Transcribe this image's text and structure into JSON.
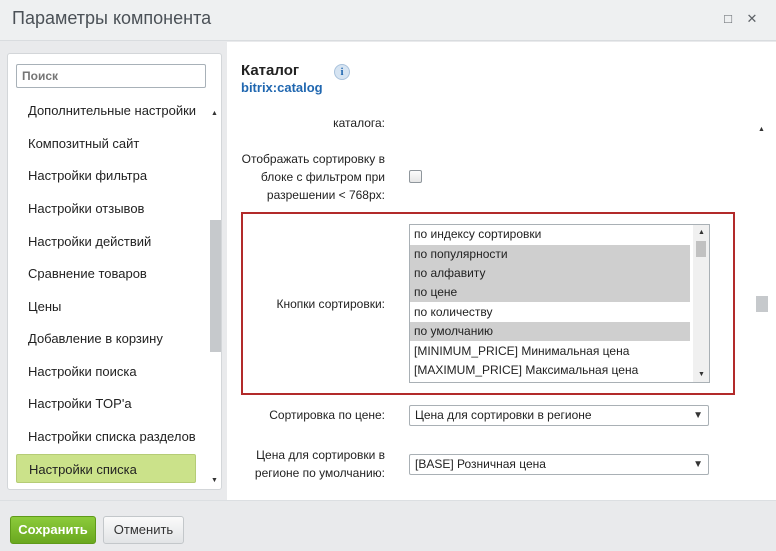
{
  "window": {
    "title": "Параметры компонента",
    "maximize_glyph": "□",
    "close_glyph": "✕"
  },
  "sidebar": {
    "search_placeholder": "Поиск",
    "items": [
      {
        "label": "Дополнительные настройки"
      },
      {
        "label": "Композитный сайт"
      },
      {
        "label": "Настройки фильтра"
      },
      {
        "label": "Настройки отзывов"
      },
      {
        "label": "Настройки действий"
      },
      {
        "label": "Сравнение товаров"
      },
      {
        "label": "Цены"
      },
      {
        "label": "Добавление в корзину"
      },
      {
        "label": "Настройки поиска"
      },
      {
        "label": "Настройки TOP'а"
      },
      {
        "label": "Настройки списка разделов"
      },
      {
        "label": "Настройки списка",
        "active": true
      }
    ]
  },
  "component": {
    "title": "Каталог",
    "id": "bitrix:catalog",
    "info_glyph": "i"
  },
  "form": {
    "catalog_label": "каталога:",
    "sort_in_filter_label_1": "Отображать сортировку в",
    "sort_in_filter_label_2": "блоке с фильтром при",
    "sort_in_filter_label_3": "разрешении < 768px:",
    "sort_buttons_label": "Кнопки сортировки:",
    "sort_buttons_options": [
      {
        "label": "по индексу сортировки",
        "selected": false
      },
      {
        "label": "по популярности",
        "selected": true
      },
      {
        "label": "по алфавиту",
        "selected": true
      },
      {
        "label": "по цене",
        "selected": true
      },
      {
        "label": "по количеству",
        "selected": false
      },
      {
        "label": "по умолчанию",
        "selected": true
      },
      {
        "label": "[MINIMUM_PRICE] Минимальная цена",
        "selected": false
      },
      {
        "label": "[MAXIMUM_PRICE] Максимальная цена",
        "selected": false
      }
    ],
    "price_sort_label": "Сортировка по цене:",
    "price_sort_value": "Цена для сортировки в регионе",
    "region_price_label_1": "Цена для сортировки в",
    "region_price_label_2": "регионе по умолчанию:",
    "region_price_value": "[BASE] Розничная цена"
  },
  "footer": {
    "save_label": "Сохранить",
    "cancel_label": "Отменить"
  },
  "colors": {
    "accent_green": "#7ab82c",
    "active_item": "#cbe28a",
    "highlight_border": "#b22a2a",
    "link_blue": "#2067b0"
  }
}
